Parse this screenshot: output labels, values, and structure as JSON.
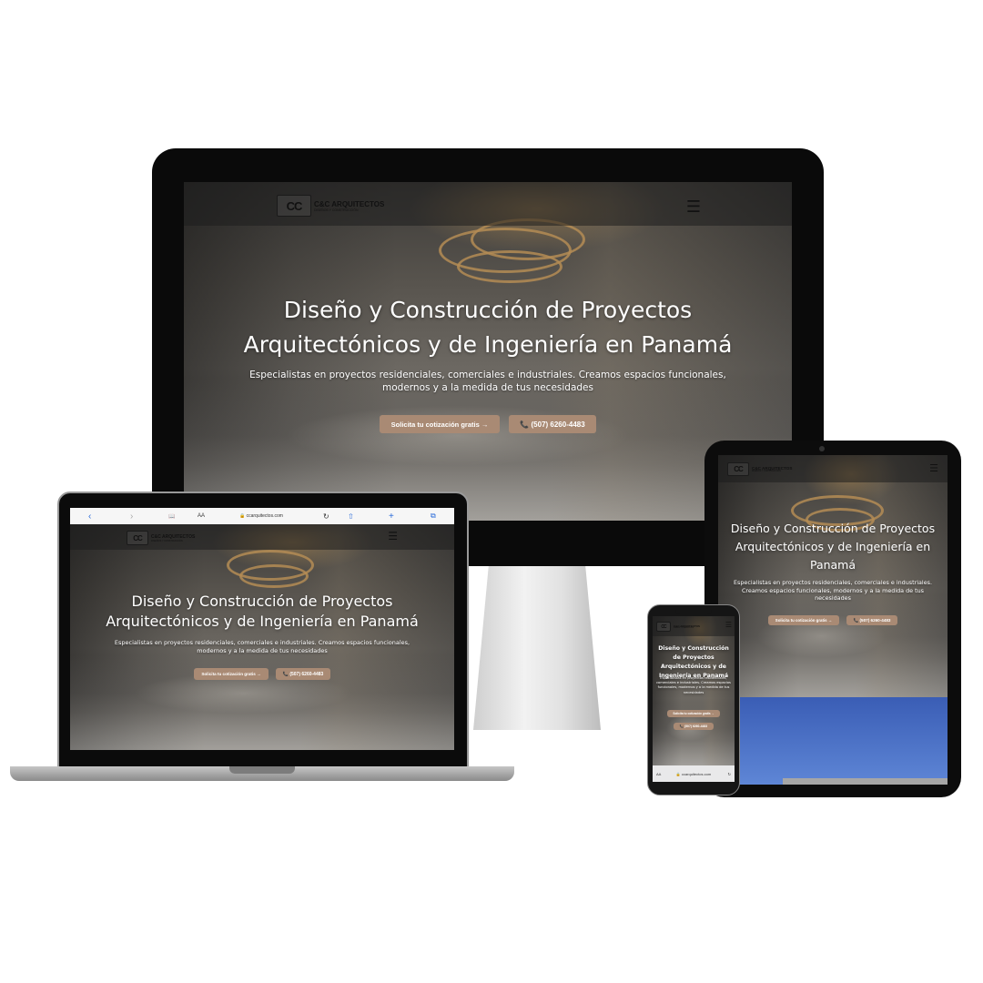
{
  "brand": {
    "name": "C&C ARQUITECTOS",
    "tagline": "DISEÑOS Y CONSTRUCCIÓN",
    "mark": "CC"
  },
  "hero": {
    "title_line1": "Diseño y Construcción de Proyectos",
    "title_line2": "Arquitectónicos y de Ingeniería en Panamá",
    "title_full": "Diseño y Construcción de Proyectos Arquitectónicos y de Ingeniería en Panamá",
    "subtitle": "Especialistas en proyectos residenciales, comerciales e industriales. Creamos espacios funcionales, modernos y a la medida de tus necesidades",
    "cta_quote": "Solicita tu cotización gratis →",
    "cta_phone": "📞 (507) 6260-4483"
  },
  "menu_icon": "hamburger-icon",
  "browser": {
    "back": "‹",
    "forward": "›",
    "bookmarks": "📖",
    "text_size": "AA",
    "url": "🔒 ccarquitectos.com",
    "reload": "↻",
    "share": "⇧",
    "add_tab": "+",
    "tabs": "⧉"
  },
  "phone_url": "🔒 ccarquitectos.com",
  "phone_url_left": "AA",
  "phone_url_right": "↻",
  "colors": {
    "cta": "#a98a74",
    "device_frame": "#0a0a0a",
    "browser_accent": "#2a6bd9"
  }
}
